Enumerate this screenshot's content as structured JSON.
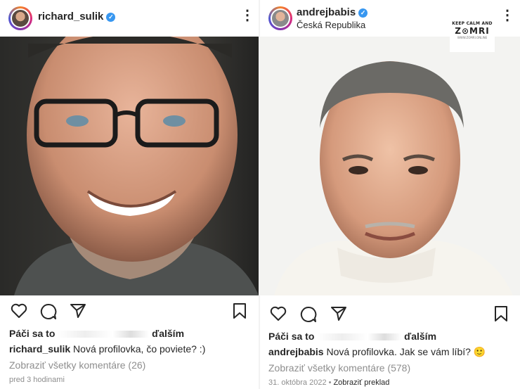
{
  "left": {
    "username": "richard_sulik",
    "likes_prefix": "Páči sa to",
    "likes_suffix": "ďalším",
    "caption_user": "richard_sulik",
    "caption_text": " Nová profilovka, čo poviete? :)",
    "comments": "Zobraziť všetky komentáre (26)",
    "time": "pred 3 hodinami"
  },
  "right": {
    "username": "andrejbabis",
    "location": "Česká Republika",
    "likes_prefix": "Páči sa to",
    "likes_suffix": "ďalším",
    "caption_user": "andrejbabis",
    "caption_text": " Nová profilovka. Jak se vám líbí? 🙂",
    "comments": "Zobraziť všetky komentáre (578)",
    "time": "31. októbra 2022",
    "translate": "Zobraziť preklad",
    "watermark": {
      "line1": "KEEP CALM AND",
      "line2": "Z⊙MRI",
      "line3": "WWW.ZOMRI.ONLINE"
    }
  },
  "icons": [
    "heart-icon",
    "comment-icon",
    "share-icon",
    "bookmark-icon",
    "more-icon",
    "verified-icon"
  ],
  "colors": {
    "text": "#262626",
    "muted": "#8e8e8e",
    "verified": "#3897f0"
  }
}
